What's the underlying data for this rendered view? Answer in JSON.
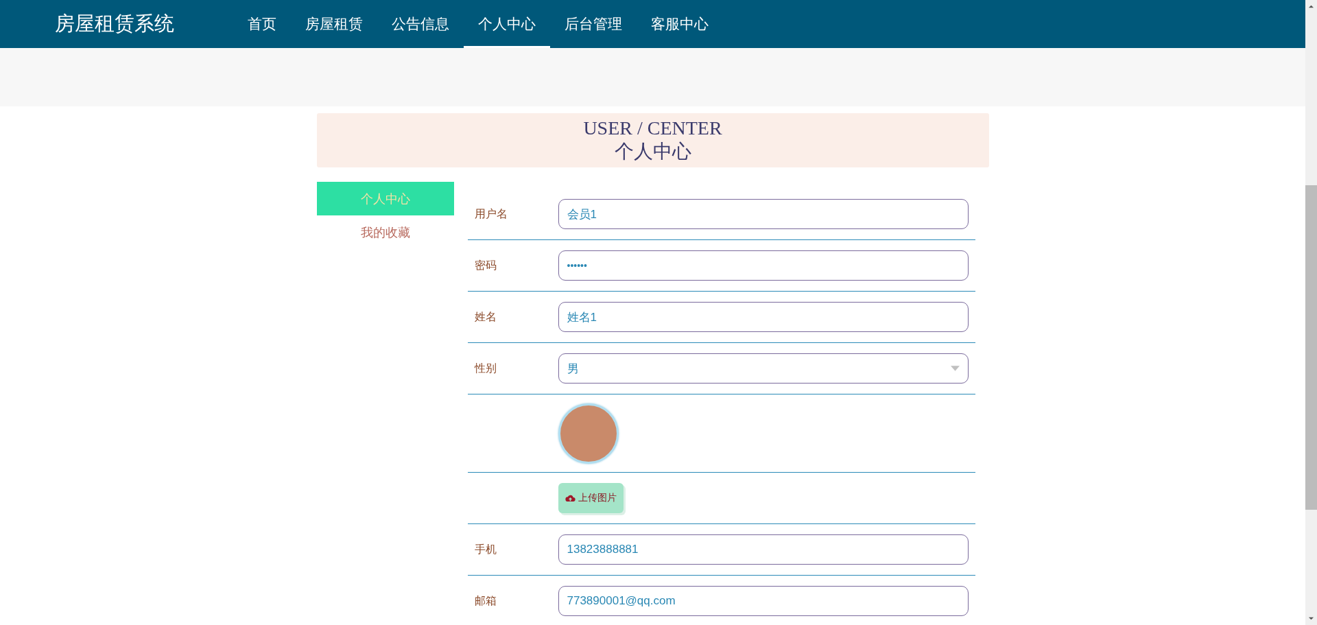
{
  "header": {
    "logo": "房屋租赁系统",
    "nav": [
      {
        "label": "首页",
        "selected": false
      },
      {
        "label": "房屋租赁",
        "selected": false
      },
      {
        "label": "公告信息",
        "selected": false
      },
      {
        "label": "个人中心",
        "selected": true
      },
      {
        "label": "后台管理",
        "selected": false
      },
      {
        "label": "客服中心",
        "selected": false
      }
    ]
  },
  "title_banner": {
    "title": "USER / CENTER",
    "subtitle": "个人中心"
  },
  "sidebar": {
    "items": [
      {
        "label": "个人中心",
        "selected": true
      },
      {
        "label": "我的收藏",
        "selected": false
      }
    ]
  },
  "form": {
    "fields": [
      {
        "kind": "text",
        "label": "用户名",
        "value": "会员1"
      },
      {
        "kind": "password",
        "label": "密码",
        "value": "••••••"
      },
      {
        "kind": "text",
        "label": "姓名",
        "value": "姓名1"
      },
      {
        "kind": "select",
        "label": "性别",
        "value": "男"
      },
      {
        "kind": "avatar"
      },
      {
        "kind": "upload",
        "button": "上传图片"
      },
      {
        "kind": "text",
        "label": "手机",
        "value": "13823888881"
      },
      {
        "kind": "text",
        "label": "邮箱",
        "value": "773890001@qq.com"
      }
    ]
  }
}
